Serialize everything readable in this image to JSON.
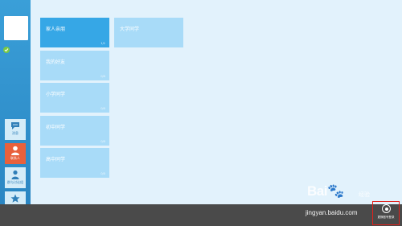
{
  "sidebar": {
    "buttons": [
      {
        "label": "消息",
        "icon": "chat-icon",
        "active": false
      },
      {
        "label": "联系人",
        "icon": "person-icon",
        "active": true
      },
      {
        "label": "群与讨论组",
        "icon": "people-icon",
        "active": false
      },
      {
        "label": "",
        "icon": "star-icon",
        "active": false
      }
    ]
  },
  "groups": [
    {
      "name": "家人亲朋",
      "count": "1/1",
      "active": true
    },
    {
      "name": "大学同学",
      "count": "",
      "active": false
    },
    {
      "name": "我的好友",
      "count": "0/0",
      "active": false
    },
    {
      "name": "小学同学",
      "count": "0/0",
      "active": false
    },
    {
      "name": "初中同学",
      "count": "0/0",
      "active": false
    },
    {
      "name": "高中同学",
      "count": "0/0",
      "active": false
    }
  ],
  "bottom_bar": {
    "settings_label": "更换账号登录"
  },
  "watermark": {
    "brand": "Bai",
    "brand_suffix": "经验",
    "url": "jingyan.baidu.com"
  },
  "colors": {
    "background": "#e2f2fc",
    "sidebar": "#2a86c3",
    "tile": "#a8dbf8",
    "tile_active": "#36a7e6",
    "active_button": "#e8613c",
    "bottom_bar": "#4a4a4a",
    "highlight": "#e0211c"
  }
}
